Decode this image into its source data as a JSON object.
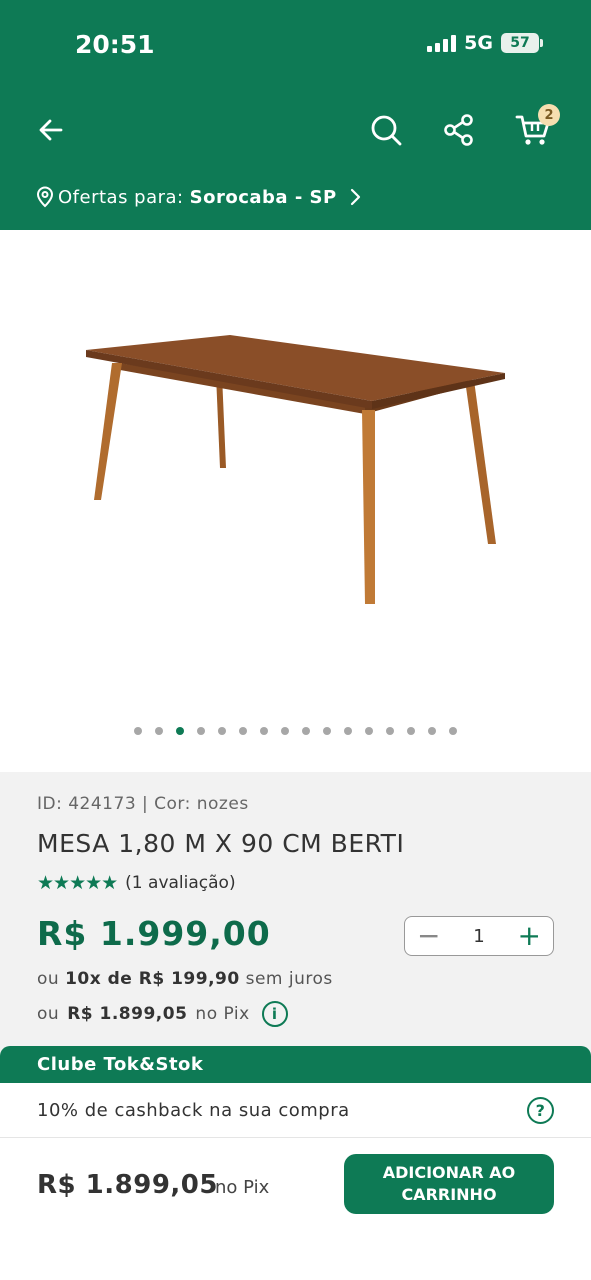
{
  "status_bar": {
    "time": "20:51",
    "network": "5G",
    "battery": "57"
  },
  "header": {
    "cart_count": "2",
    "location_label": "Ofertas para:",
    "location_value": "Sorocaba - SP"
  },
  "gallery": {
    "image_count": 16,
    "active_index": 2
  },
  "product": {
    "id_line": "ID: 424173 | Cor: nozes",
    "title": "MESA 1,80 M X 90 CM BERTI",
    "stars": "★★★★★",
    "rating_text": "(1 avaliação)",
    "price": "R$ 1.999,00",
    "quantity": "1",
    "inst_prefix": "ou",
    "inst_bold": "10x de R$ 199,90",
    "inst_suffix": "sem juros",
    "pix_prefix": "ou",
    "pix_bold": "R$ 1.899,05",
    "pix_suffix": "no Pix"
  },
  "club": {
    "title": "Clube Tok&Stok",
    "text": "10% de cashback na sua compra"
  },
  "footer": {
    "price": "R$ 1.899,05",
    "price_suffix": "no Pix",
    "add_button": "ADICIONAR AO CARRINHO"
  }
}
